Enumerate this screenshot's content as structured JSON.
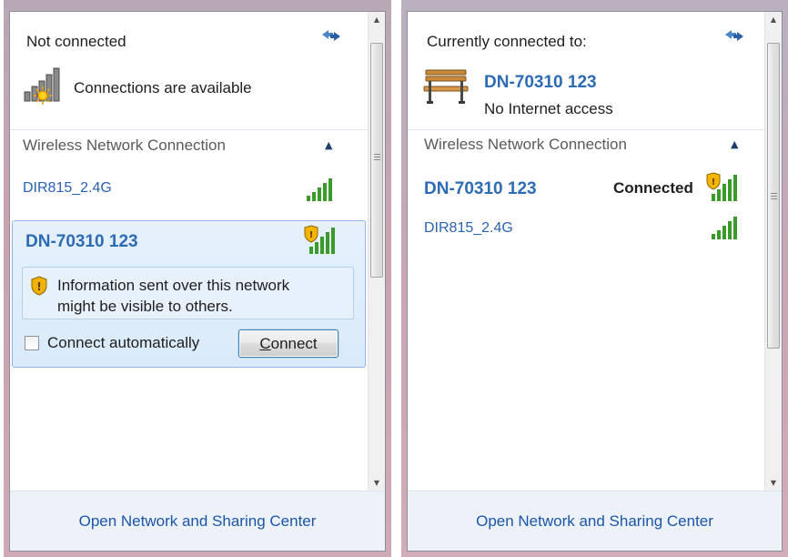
{
  "left_flyout": {
    "status_title": "Not connected",
    "status_subtitle": "Connections are available",
    "section_label": "Wireless Network Connection",
    "networks": [
      {
        "name": "DIR815_2.4G",
        "secured": true
      },
      {
        "name": "DN-70310 123",
        "secured": false,
        "expanded": true
      }
    ],
    "expanded_network": {
      "name": "DN-70310 123",
      "warning_line1": "Information sent over this network",
      "warning_line2": "might be visible to others.",
      "auto_connect_label": "Connect automatically",
      "auto_connect_checked": false,
      "connect_button_accel": "C",
      "connect_button_rest": "onnect"
    },
    "footer_link": "Open Network and Sharing Center"
  },
  "right_flyout": {
    "status_title": "Currently connected to:",
    "connected_network": "DN-70310 123",
    "internet_status": "No Internet access",
    "section_label": "Wireless Network Connection",
    "networks": [
      {
        "name": "DN-70310 123",
        "status": "Connected",
        "secured": false
      },
      {
        "name": "DIR815_2.4G",
        "secured": true
      }
    ],
    "footer_link": "Open Network and Sharing Center"
  },
  "icons": {
    "refresh": "refresh-icon",
    "signal": "signal-strength-icon",
    "shield": "security-shield-icon",
    "bench": "unidentified-network-bench-icon",
    "collapse": "chevron-up-icon"
  },
  "colors": {
    "link_blue": "#1a55a8",
    "network_blue": "#2d6bb4",
    "signal_green": "#3a9a2a",
    "selection_bg": "#d9eafb"
  }
}
